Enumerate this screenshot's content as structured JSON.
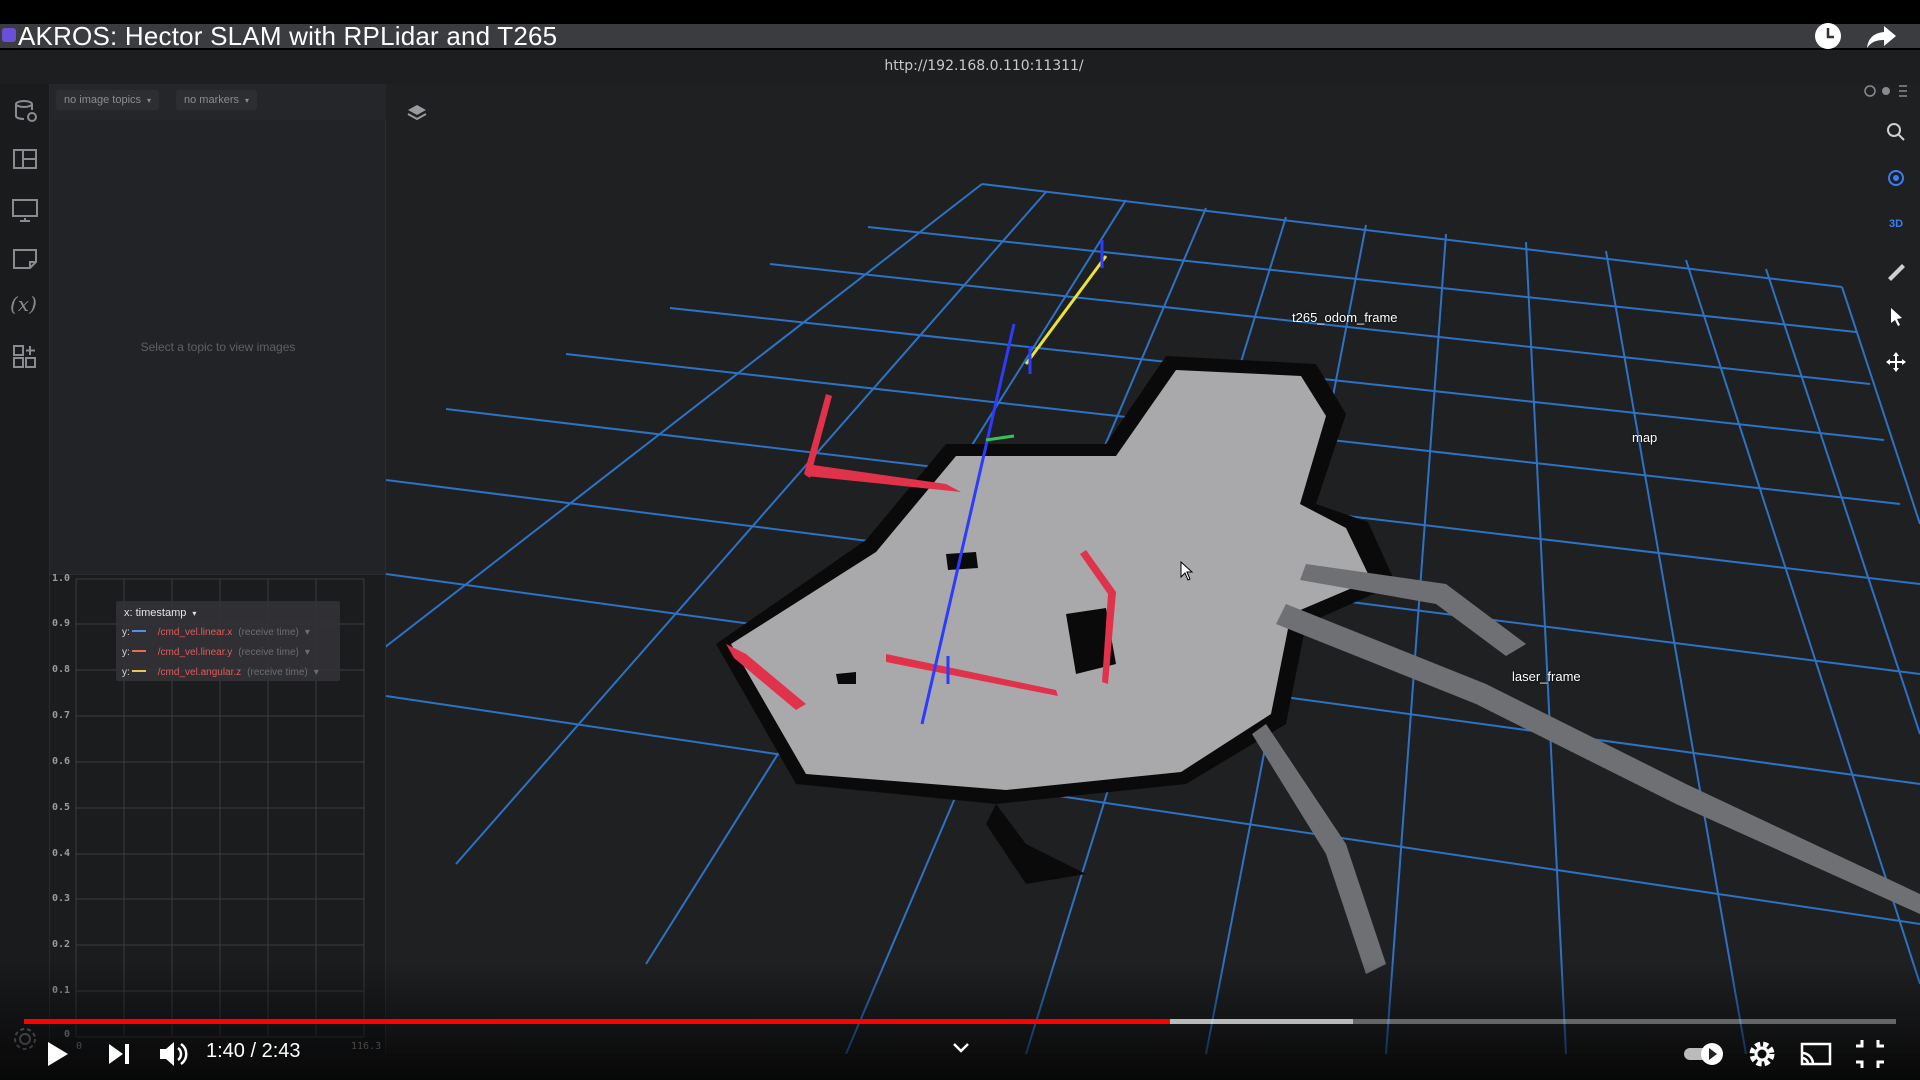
{
  "video": {
    "title": "AKROS: Hector SLAM with RPLidar and T265",
    "current_time": "1:40",
    "separator": " / ",
    "duration": "2:43",
    "progress_fraction": 0.612,
    "buffered_fraction": 0.71
  },
  "app": {
    "url": "http://192.168.0.110:11311/",
    "rail_icons": [
      "data-source-icon",
      "layout-icon",
      "panel-add-icon",
      "note-icon",
      "variables-icon",
      "extensions-icon"
    ],
    "variables_glyph": "(x)"
  },
  "image_panel": {
    "topics_dropdown": "no image topics",
    "markers_dropdown": "no markers",
    "hint": "Select a topic to view images"
  },
  "plot_panel": {
    "x_label": "x: timestamp",
    "series": [
      {
        "axis": "y:",
        "topic": "/cmd_vel.linear.x",
        "time": "(receive time)",
        "color": "#4f8fe8"
      },
      {
        "axis": "y:",
        "topic": "/cmd_vel.linear.y",
        "time": "(receive time)",
        "color": "#e86d4f"
      },
      {
        "axis": "y:",
        "topic": "/cmd_vel.angular.z",
        "time": "(receive time)",
        "color": "#e8c74f"
      }
    ],
    "y_ticks": [
      "1.0",
      "0.9",
      "0.8",
      "0.7",
      "0.6",
      "0.5",
      "0.4",
      "0.3",
      "0.2",
      "0.1",
      "0"
    ],
    "x_ticks": [
      "0",
      "116.3"
    ]
  },
  "scene": {
    "frames": {
      "t265": "t265_odom_frame",
      "map": "map",
      "laser": "laser_frame"
    },
    "tools": [
      "search-icon",
      "follow-icon",
      "3d-toggle-icon",
      "measure-icon",
      "select-icon",
      "move-icon"
    ],
    "mode_label": "3D"
  },
  "colors": {
    "grid": "#2f7bd6",
    "play_head": "#ff0000",
    "axis_blue": "#2c3cff",
    "link_yellow": "#e8e23a",
    "scan_red": "#e0324b"
  }
}
